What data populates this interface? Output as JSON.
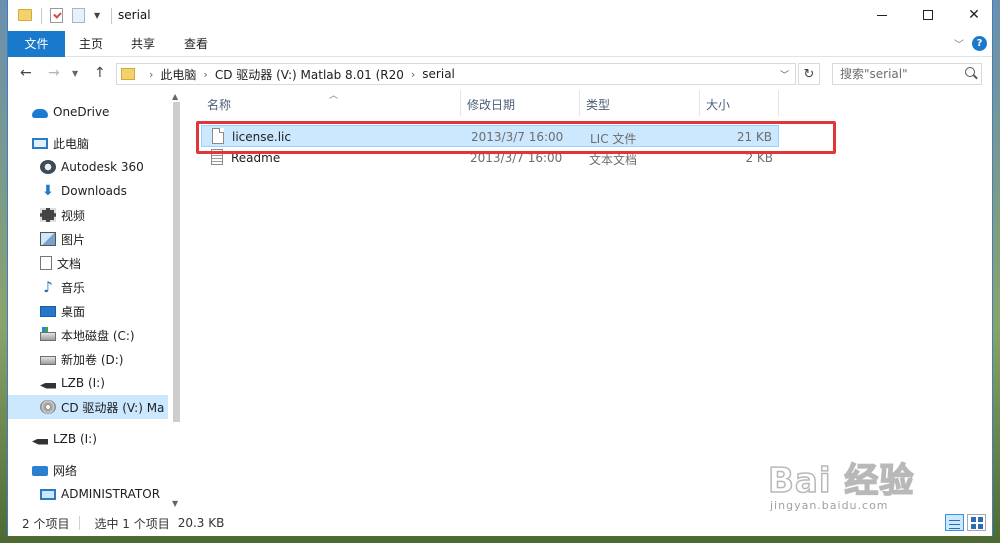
{
  "window": {
    "title": "serial"
  },
  "ribbon": {
    "tabs": [
      "文件",
      "主页",
      "共享",
      "查看"
    ]
  },
  "address": {
    "crumbs": [
      "此电脑",
      "CD 驱动器 (V:) Matlab 8.01 (R20",
      "serial"
    ],
    "search_placeholder": "搜索\"serial\""
  },
  "nav": {
    "items": [
      {
        "label": "OneDrive",
        "icon": "onedrive-icon"
      },
      {
        "label": "此电脑",
        "icon": "computer-icon"
      },
      {
        "label": "Autodesk 360",
        "icon": "autodesk-360-icon"
      },
      {
        "label": "Downloads",
        "icon": "downloads-icon"
      },
      {
        "label": "视频",
        "icon": "video-icon"
      },
      {
        "label": "图片",
        "icon": "picture-icon"
      },
      {
        "label": "文档",
        "icon": "document-icon"
      },
      {
        "label": "音乐",
        "icon": "music-icon"
      },
      {
        "label": "桌面",
        "icon": "desktop-icon"
      },
      {
        "label": "本地磁盘 (C:)",
        "icon": "drive-icon"
      },
      {
        "label": "新加卷 (D:)",
        "icon": "drive-icon"
      },
      {
        "label": "LZB (I:)",
        "icon": "usb-drive-icon"
      },
      {
        "label": "CD 驱动器 (V:) Ma",
        "icon": "cd-drive-icon"
      },
      {
        "label": "LZB (I:)",
        "icon": "usb-drive-icon"
      },
      {
        "label": "网络",
        "icon": "network-icon"
      },
      {
        "label": "ADMINISTRATOR",
        "icon": "monitor-icon"
      }
    ]
  },
  "columns": {
    "name": "名称",
    "date": "修改日期",
    "type": "类型",
    "size": "大小"
  },
  "files": [
    {
      "name": "license.lic",
      "date": "2013/3/7 16:00",
      "type": "LIC 文件",
      "size": "21 KB"
    },
    {
      "name": "Readme",
      "date": "2013/3/7 16:00",
      "type": "文本文档",
      "size": "2 KB"
    }
  ],
  "status": {
    "count": "2 个项目",
    "selected": "选中 1 个项目",
    "size": "20.3 KB"
  },
  "watermark": {
    "brand": "Bai  经验",
    "url": "jingyan.baidu.com"
  },
  "colors": {
    "accent": "#1979ca",
    "selection": "#cce8ff",
    "highlight_box": "#e0363a"
  }
}
